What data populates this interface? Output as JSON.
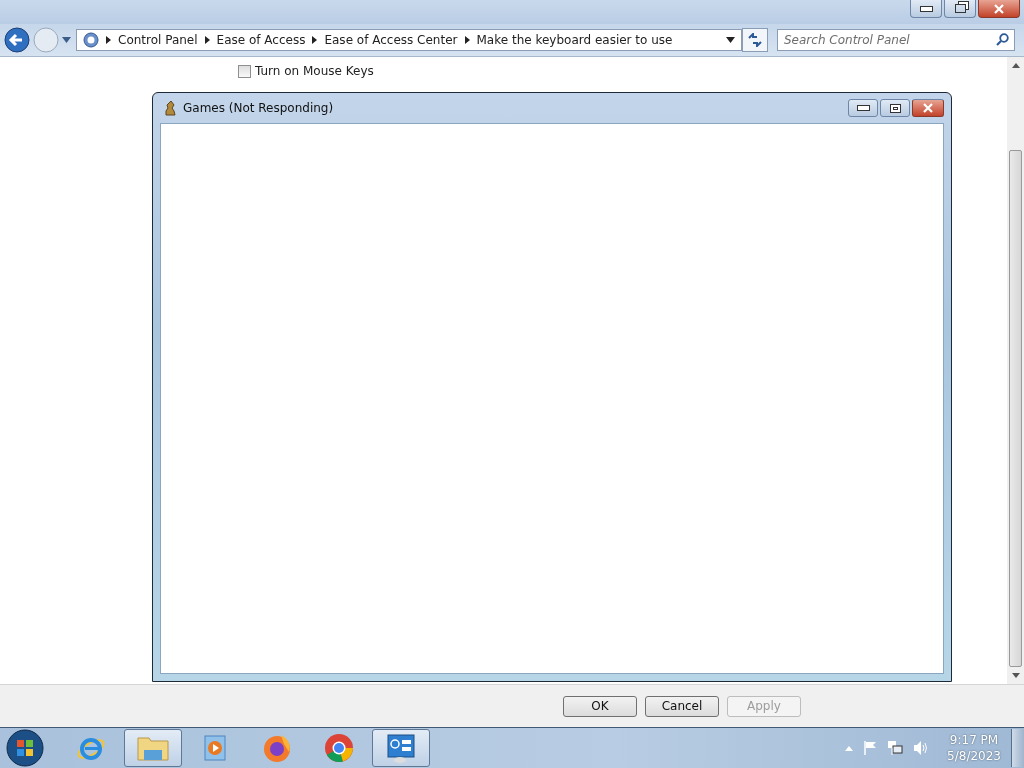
{
  "explorer": {
    "breadcrumb": [
      "Control Panel",
      "Ease of Access",
      "Ease of Access Center",
      "Make the keyboard easier to use"
    ],
    "search": {
      "placeholder": "Search Control Panel"
    },
    "options": [
      {
        "label": "Turn on Mouse Keys",
        "checked": false
      }
    ],
    "buttons": [
      {
        "label": "OK",
        "disabled": false
      },
      {
        "label": "Cancel",
        "disabled": false
      },
      {
        "label": "Apply",
        "disabled": true
      }
    ]
  },
  "dialog": {
    "title": "Games (Not Responding)"
  },
  "taskbar": {
    "items": [
      {
        "kind": "ie",
        "running": false
      },
      {
        "kind": "folder",
        "running": true
      },
      {
        "kind": "media",
        "running": false
      },
      {
        "kind": "firefox",
        "running": false
      },
      {
        "kind": "chrome",
        "running": false
      },
      {
        "kind": "panel",
        "running": true
      }
    ],
    "time": "9:17 PM",
    "date": "5/8/2023"
  }
}
